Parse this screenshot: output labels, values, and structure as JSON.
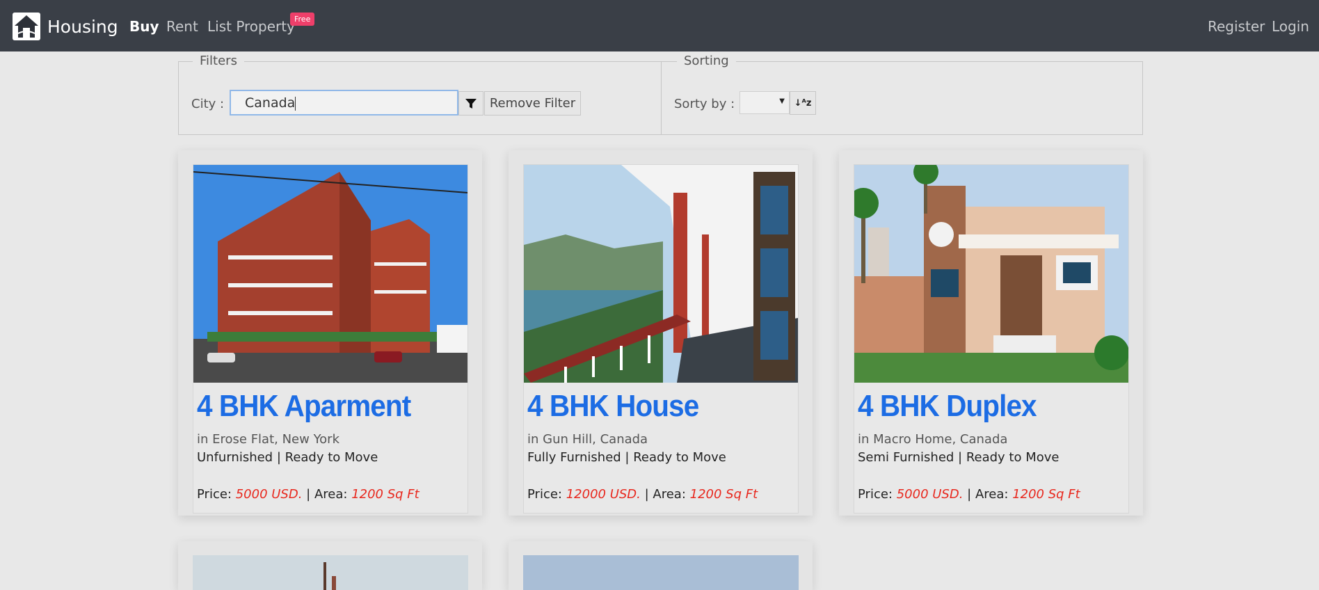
{
  "navbar": {
    "brand": "Housing",
    "links": {
      "buy": "Buy",
      "rent": "Rent",
      "list_property": "List Property"
    },
    "badge": "Free",
    "register": "Register",
    "login": "Login"
  },
  "filters": {
    "legend": "Filters",
    "city_label": "City :",
    "city_value": "Canada",
    "remove_label": "Remove Filter"
  },
  "sorting": {
    "legend": "Sorting",
    "sort_label": "Sorty by :",
    "selected": ""
  },
  "listings": [
    {
      "title": "4 BHK Aparment",
      "location": "in Erose Flat, New York",
      "furnishing": "Unfurnished | Ready to Move",
      "price_label": "Price:",
      "price": "5000 USD.",
      "area_label": "| Area:",
      "area": "1200 Sq Ft"
    },
    {
      "title": "4 BHK House",
      "location": "in Gun Hill, Canada",
      "furnishing": "Fully Furnished | Ready to Move",
      "price_label": "Price:",
      "price": "12000 USD.",
      "area_label": "| Area:",
      "area": "1200 Sq Ft"
    },
    {
      "title": "4 BHK Duplex",
      "location": "in Macro Home, Canada",
      "furnishing": "Semi Furnished | Ready to Move",
      "price_label": "Price:",
      "price": "5000 USD.",
      "area_label": "| Area:",
      "area": "1200 Sq Ft"
    }
  ],
  "colors": {
    "navbar": "#3a3f47",
    "title_blue": "#1c6ce4",
    "price_red": "#e8281e",
    "badge": "#ee3f6a"
  },
  "icons": [
    "house-logo-icon",
    "filter-icon",
    "sort-alpha-icon",
    "dropdown-arrow-icon"
  ]
}
